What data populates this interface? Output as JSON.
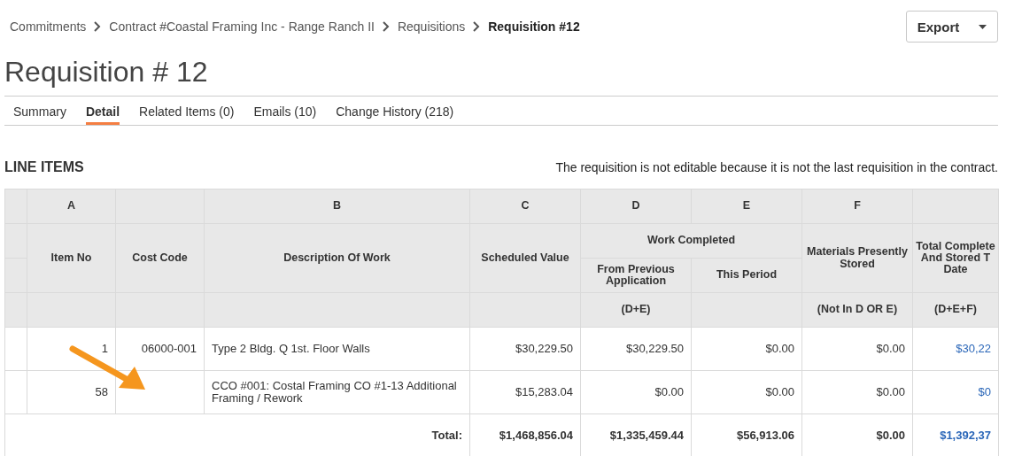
{
  "breadcrumbs": [
    {
      "label": "Commitments",
      "current": false
    },
    {
      "label": "Contract #Coastal Framing Inc - Range Ranch II",
      "current": false
    },
    {
      "label": "Requisitions",
      "current": false
    },
    {
      "label": "Requisition #12",
      "current": true
    }
  ],
  "export_button": {
    "label": "Export"
  },
  "title": "Requisition # 12",
  "tabs": [
    {
      "label": "Summary",
      "selected": false
    },
    {
      "label": "Detail",
      "selected": true
    },
    {
      "label": "Related Items (0)",
      "selected": false
    },
    {
      "label": "Emails (10)",
      "selected": false
    },
    {
      "label": "Change History (218)",
      "selected": false
    }
  ],
  "section_title": "LINE ITEMS",
  "notice": "The requisition is not editable because it is not the last requisition in the contract.",
  "column_group": {
    "label": "Work Completed"
  },
  "columns": [
    {
      "letter": "A",
      "name": "Item No",
      "grouped": false
    },
    {
      "name": "Cost Code",
      "grouped": false
    },
    {
      "letter": "B",
      "name": "Description Of Work",
      "grouped": false
    },
    {
      "letter": "C",
      "name": "Scheduled Value",
      "grouped": false
    },
    {
      "letter": "D",
      "name": "From Previous Application",
      "formula": "(D+E)",
      "grouped": true
    },
    {
      "letter": "E",
      "name": "This Period",
      "grouped": true
    },
    {
      "letter": "F",
      "name": "Materials Presently Stored",
      "formula": "(Not In D OR E)",
      "grouped": false
    },
    {
      "name": "Total Complete\nAnd Stored T\nDate",
      "formula": "(D+E+F)",
      "grouped": false
    }
  ],
  "rows": [
    {
      "cells": [
        "1",
        "06000-001",
        "Type 2 Bldg. Q 1st. Floor Walls",
        "$30,229.50",
        "$30,229.50",
        "$0.00",
        "$0.00",
        "$30,22"
      ]
    },
    {
      "cells": [
        "58",
        null,
        "CCO #001: Costal Framing CO #1-13 Additional Framing / Rework",
        "$15,283.04",
        "$0.00",
        "$0.00",
        "$0.00",
        "$0"
      ]
    }
  ],
  "total_row": {
    "label": "Total:",
    "values": [
      "$1,468,856.04",
      "$1,335,459.44",
      "$56,913.06",
      "$0.00",
      "$1,392,37"
    ]
  }
}
